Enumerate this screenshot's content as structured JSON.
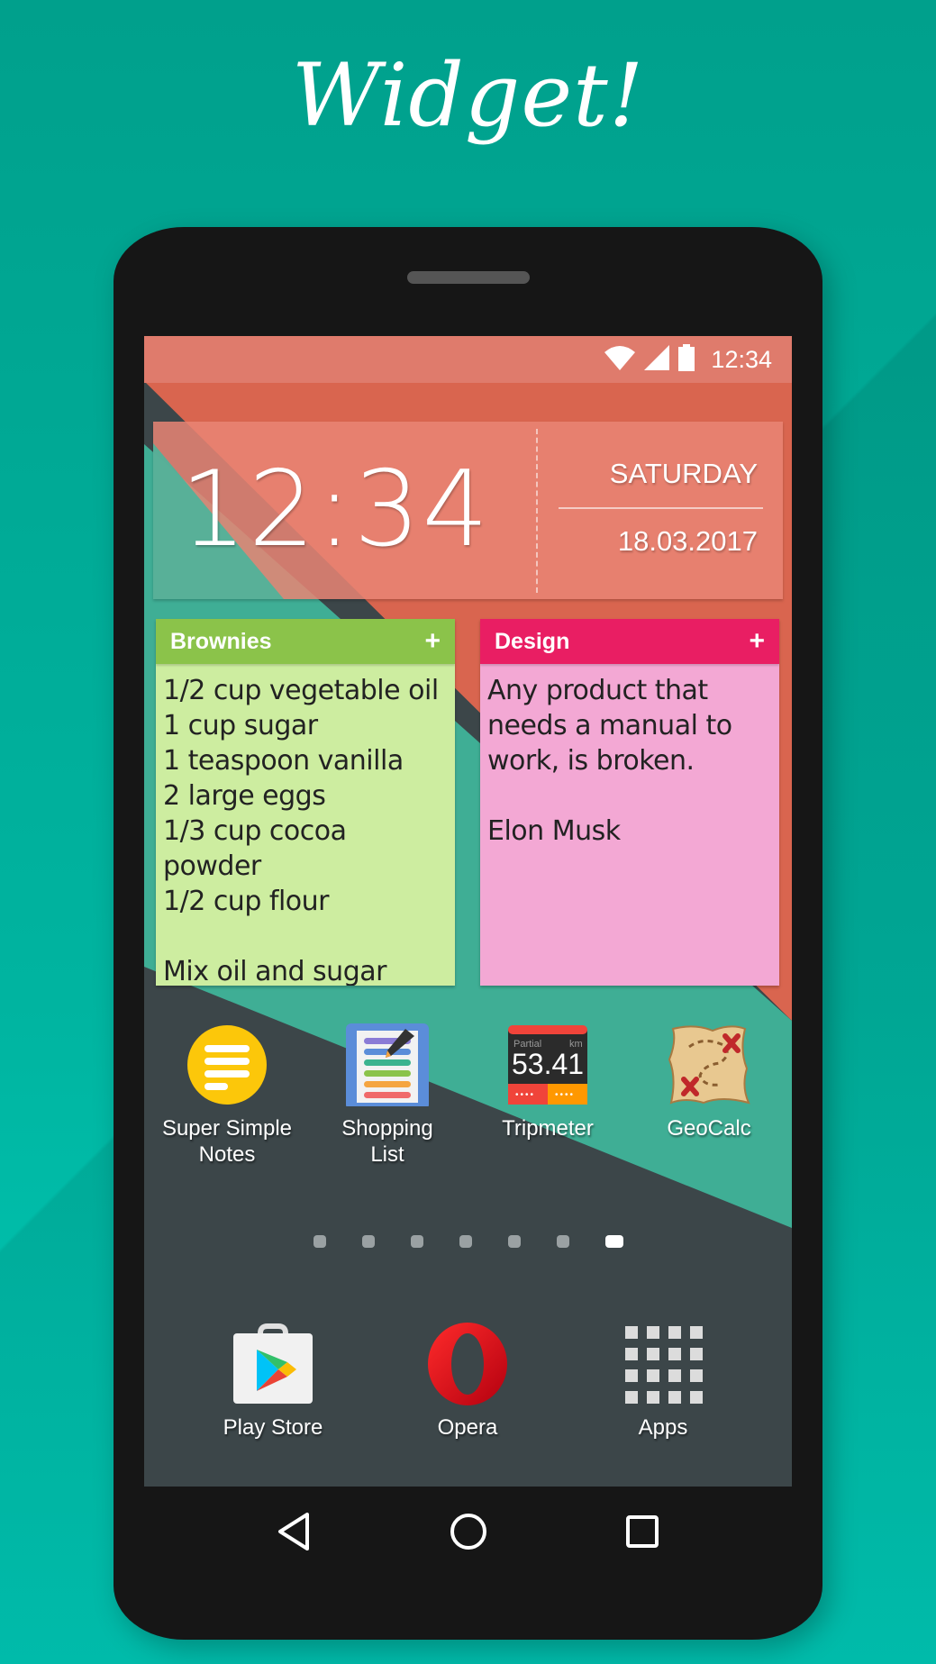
{
  "promo": {
    "title": "Widget!"
  },
  "statusbar": {
    "time": "12:34",
    "icons": [
      "wifi-icon",
      "cell-signal-icon",
      "battery-icon"
    ]
  },
  "clock_widget": {
    "time": "12:34",
    "day": "SATURDAY",
    "date": "18.03.2017"
  },
  "notes": [
    {
      "title": "Brownies",
      "add_label": "+",
      "color_header": "#8bc34a",
      "color_body": "#cdeda0",
      "body": "1/2 cup vegetable oil\n1 cup sugar\n1 teaspoon vanilla\n2 large eggs\n1/3 cup cocoa\npowder\n1/2 cup flour\n\nMix oil and sugar until"
    },
    {
      "title": "Design",
      "add_label": "+",
      "color_header": "#e91e63",
      "color_body": "#f3a8d4",
      "body": "Any product that\nneeds a manual to\nwork, is broken.\n\nElon Musk"
    }
  ],
  "apps": [
    {
      "label": "Super Simple\nNotes",
      "icon": "notes-icon"
    },
    {
      "label": "Shopping\nList",
      "icon": "shopping-list-icon"
    },
    {
      "label": "Tripmeter",
      "icon": "tripmeter-icon",
      "icon_text": {
        "partial": "Partial",
        "unit": "km",
        "value": "53.41",
        "dots": "••••"
      }
    },
    {
      "label": "GeoCalc",
      "icon": "treasure-map-icon"
    }
  ],
  "pager": {
    "pages": 7,
    "active_index": 6
  },
  "dock": [
    {
      "label": "Play Store",
      "icon": "play-store-icon"
    },
    {
      "label": "Opera",
      "icon": "opera-icon"
    },
    {
      "label": "Apps",
      "icon": "app-drawer-icon"
    }
  ],
  "navbar": {
    "buttons": [
      "back",
      "home",
      "recents"
    ]
  }
}
